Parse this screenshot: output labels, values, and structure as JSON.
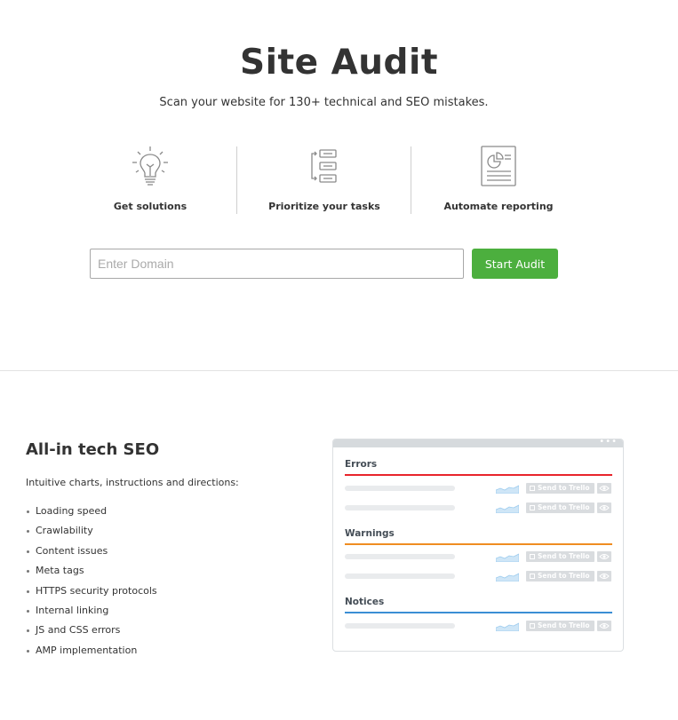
{
  "hero": {
    "title": "Site Audit",
    "subtitle": "Scan your website for 130+ technical and SEO mistakes."
  },
  "features": [
    {
      "label": "Get solutions",
      "icon": "lightbulb-icon"
    },
    {
      "label": "Prioritize your tasks",
      "icon": "task-list-icon"
    },
    {
      "label": "Automate reporting",
      "icon": "report-icon"
    }
  ],
  "search": {
    "placeholder": "Enter Domain",
    "value": "",
    "button_label": "Start Audit"
  },
  "tech_seo": {
    "title": "All-in tech SEO",
    "description": "Intuitive charts, instructions and directions:",
    "items": [
      "Loading speed",
      "Crawlability",
      "Content issues",
      "Meta tags",
      "HTTPS security protocols",
      "Internal linking",
      "JS and CSS errors",
      "AMP implementation"
    ]
  },
  "mockup": {
    "dots": "•••",
    "groups": [
      {
        "title": "Errors",
        "color": "#e8242b",
        "rows": 2
      },
      {
        "title": "Warnings",
        "color": "#ef8d22",
        "rows": 2
      },
      {
        "title": "Notices",
        "color": "#3b8ed4",
        "rows": 1
      }
    ],
    "trello_label": "Send to Trello"
  },
  "colors": {
    "accent_green": "#4caf3e",
    "error_red": "#e8242b",
    "warning_orange": "#ef8d22",
    "notice_blue": "#3b8ed4"
  }
}
